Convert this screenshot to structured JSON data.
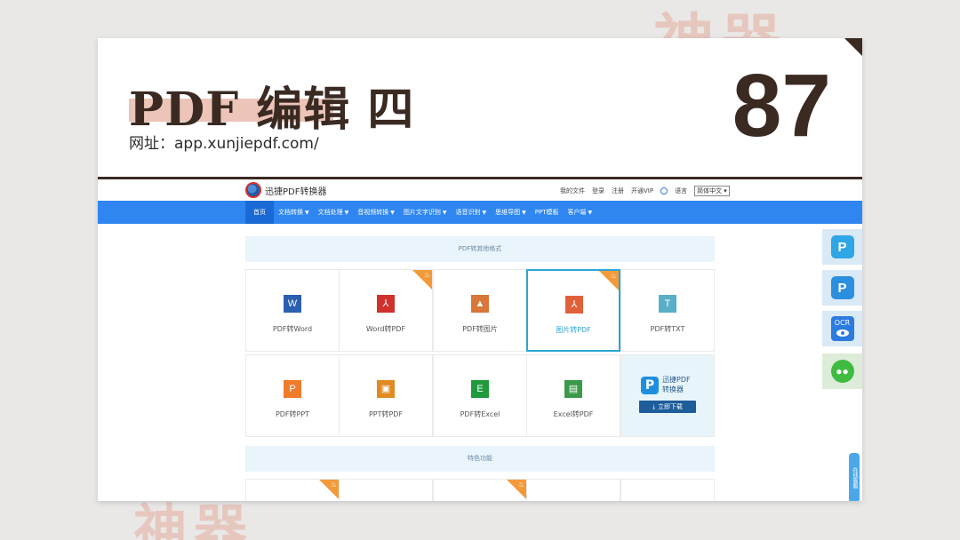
{
  "background": {
    "deco_top": "神器",
    "deco_bottom": "神器"
  },
  "slide": {
    "title": "PDF 编辑 四",
    "url_label": "网址：app.xunjiepdf.com/",
    "number": "87"
  },
  "site": {
    "logo_text": "迅捷PDF转换器",
    "top_links": [
      "我的文件",
      "登录",
      "注册",
      "开通VIP"
    ],
    "lang_label": "语言",
    "lang_value": "简体中文",
    "nav": [
      {
        "label": "首页",
        "dropdown": false
      },
      {
        "label": "文档转换",
        "dropdown": true
      },
      {
        "label": "文档处理",
        "dropdown": true
      },
      {
        "label": "音视频转换",
        "dropdown": true
      },
      {
        "label": "图片文字识别",
        "dropdown": true
      },
      {
        "label": "语音识别",
        "dropdown": true
      },
      {
        "label": "思维导图",
        "dropdown": true
      },
      {
        "label": "PPT模板",
        "dropdown": false
      },
      {
        "label": "客户端",
        "dropdown": true
      }
    ],
    "section1_title": "PDF转其他格式",
    "section2_title": "特色功能",
    "tools": [
      {
        "label": "PDF转Word",
        "icon": "word-icon",
        "glyph": "W",
        "color": "#2b5fb0",
        "hot": false
      },
      {
        "label": "Word转PDF",
        "icon": "pdf-icon",
        "glyph": "⅄",
        "color": "#d0312d",
        "hot": false
      },
      {
        "label": "PDF转图片",
        "icon": "image-icon",
        "glyph": "▲",
        "color": "#d9773a",
        "hot": false
      },
      {
        "label": "图片转PDF",
        "icon": "pdf-icon",
        "glyph": "⅄",
        "color": "#e0603a",
        "hot": true
      },
      {
        "label": "PDF转TXT",
        "icon": "txt-icon",
        "glyph": "T",
        "color": "#5aaec8",
        "hot": false
      },
      {
        "label": "PDF转PPT",
        "icon": "ppt-icon",
        "glyph": "P",
        "color": "#f07b2a",
        "hot": false
      },
      {
        "label": "PPT转PDF",
        "icon": "ppt-pdf-icon",
        "glyph": "▣",
        "color": "#e08a20",
        "hot": false
      },
      {
        "label": "PDF转Excel",
        "icon": "excel-icon",
        "glyph": "E",
        "color": "#1f9a3c",
        "hot": false
      },
      {
        "label": "Excel转PDF",
        "icon": "excel-pdf-icon",
        "glyph": "▤",
        "color": "#3a9a4a",
        "hot": false
      }
    ],
    "promo": {
      "title_line1": "迅捷PDF",
      "title_line2": "转换器",
      "download_label": "立即下载"
    },
    "sidebar": {
      "ocr_label": "OCR",
      "feedback_label": "在线客服"
    }
  },
  "colors": {
    "nav_blue": "#2f86f0",
    "accent_brown": "#3a2a22",
    "hot_orange": "#f29a3a",
    "selected_border": "#2aa6d4"
  }
}
